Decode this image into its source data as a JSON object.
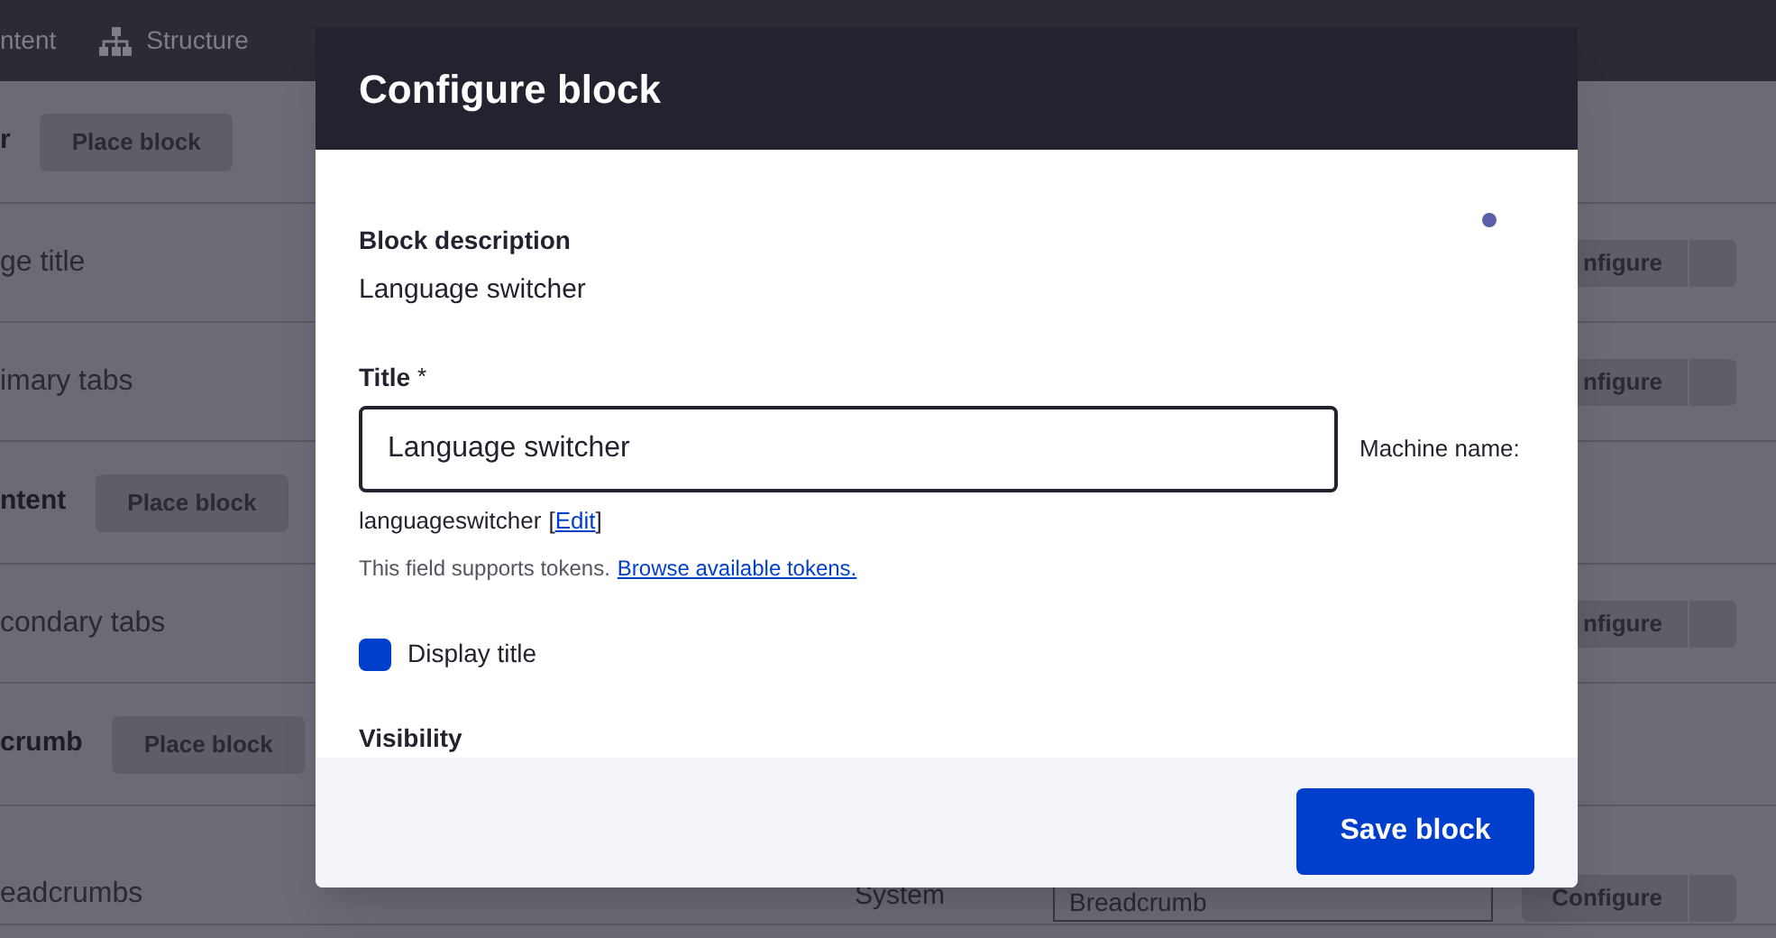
{
  "toolbar": {
    "items": [
      "ntent",
      "Structure"
    ]
  },
  "page_rows": [
    {
      "kind": "region",
      "label": "r",
      "button": "Place block"
    },
    {
      "kind": "block",
      "label": "ge title",
      "button": "nfigure"
    },
    {
      "kind": "block",
      "label": "imary tabs",
      "button": "nfigure"
    },
    {
      "kind": "region",
      "label": "ntent",
      "button": "Place block"
    },
    {
      "kind": "block",
      "label": "condary tabs",
      "button": "nfigure"
    },
    {
      "kind": "region",
      "label": "crumb",
      "button": "Place block"
    },
    {
      "kind": "block",
      "label": "eadcrumbs",
      "category": "System",
      "region_select": "Breadcrumb",
      "button": "Configure"
    }
  ],
  "dialog": {
    "title": "Configure block",
    "description_label": "Block description",
    "description": "Language switcher",
    "title_field": {
      "label": "Title",
      "required_mark": "*",
      "value": "Language switcher",
      "side_label": "Machine name:"
    },
    "machine_name": "languageswitcher",
    "machine_edit_open": "[",
    "machine_edit": "Edit",
    "machine_edit_close": "]",
    "help": "This field supports tokens.",
    "help_link": "Browse available tokens.",
    "display_title": {
      "label": "Display title",
      "checked": true
    },
    "section": "Visibility",
    "save_button": "Save block"
  }
}
